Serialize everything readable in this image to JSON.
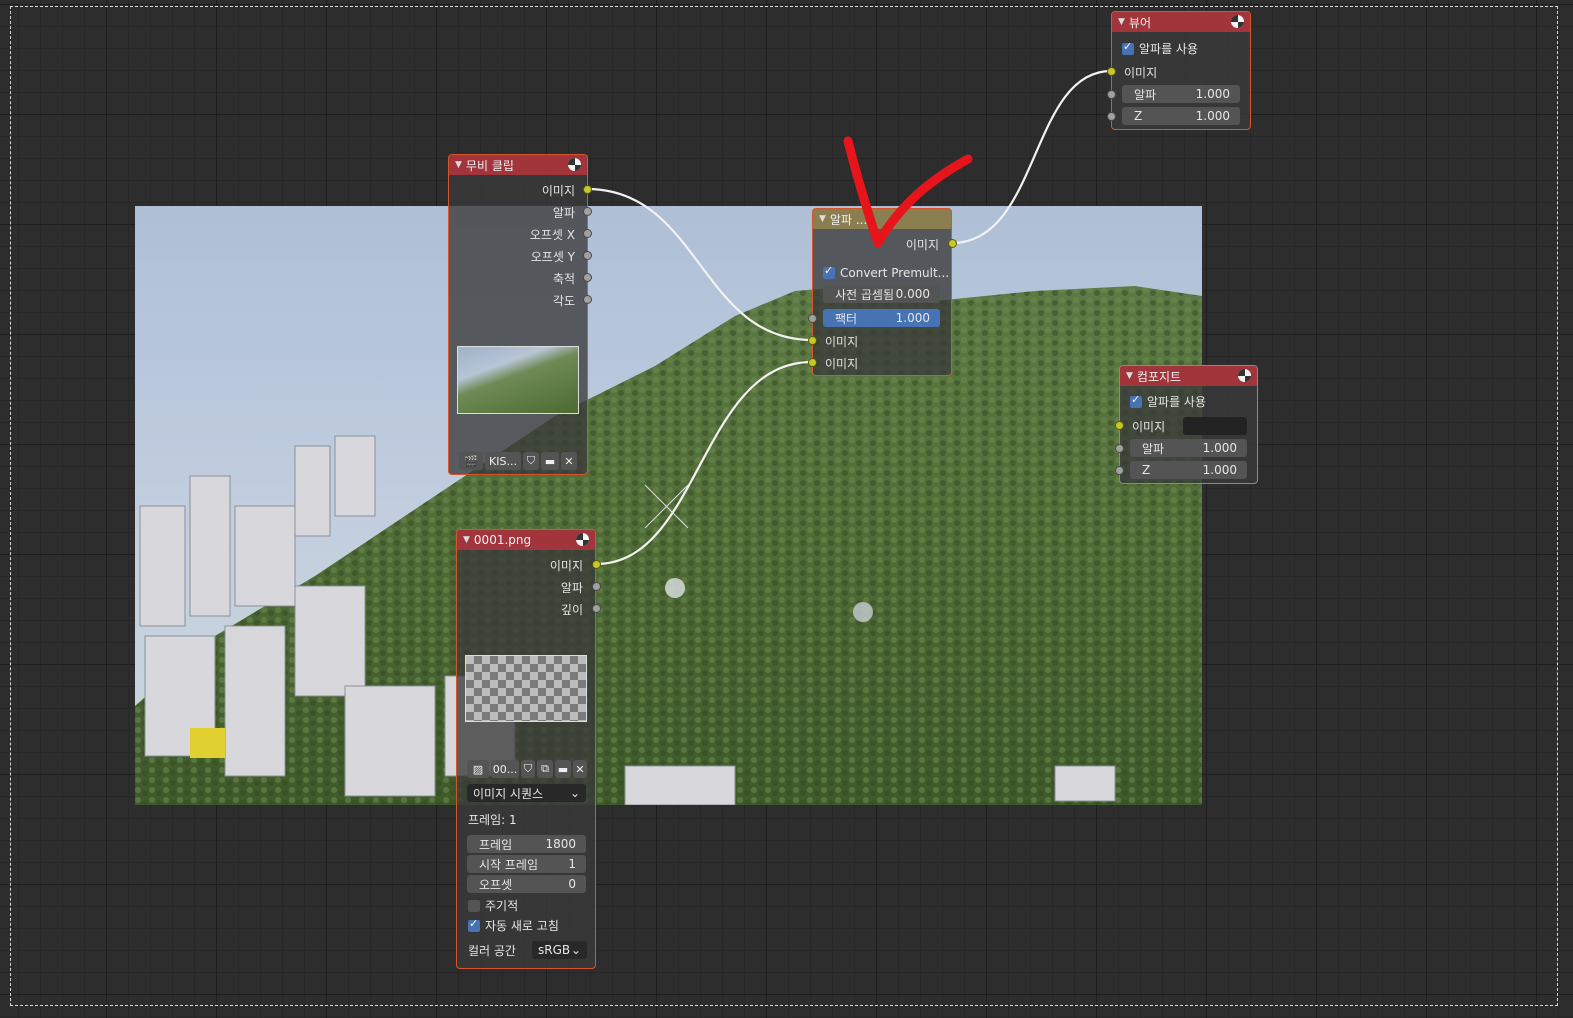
{
  "colors": {
    "accent": "#4772b3",
    "socket_image": "#c7c729",
    "socket_value": "#a1a1a1",
    "node_border": "#d5562b",
    "header_red": "#a2343b",
    "header_olive": "#8b7f52",
    "annotation": "#e8141c"
  },
  "viewer": {
    "title": "뷰어",
    "use_alpha": "알파를 사용",
    "in_image": "이미지",
    "alpha_label": "알파",
    "alpha_value": "1.000",
    "z_label": "Z",
    "z_value": "1.000"
  },
  "movie_clip": {
    "title": "무비 클립",
    "outputs": [
      "이미지",
      "알파",
      "오프셋 X",
      "오프셋 Y",
      "축적",
      "각도"
    ],
    "clip_name": "KIS..."
  },
  "alpha_over": {
    "title": "알파 ...",
    "out_image": "이미지",
    "convert_premult": "Convert Premult...",
    "premul_label": "사전 곱셈됨",
    "premul_value": "0.000",
    "factor_label": "팩터",
    "factor_value": "1.000",
    "in_image_1": "이미지",
    "in_image_2": "이미지"
  },
  "composite": {
    "title": "컴포지트",
    "use_alpha": "알파를 사용",
    "in_image": "이미지",
    "alpha_label": "알파",
    "alpha_value": "1.000",
    "z_label": "Z",
    "z_value": "1.000"
  },
  "image_node": {
    "title": "0001.png",
    "outputs": [
      "이미지",
      "알파",
      "깊이"
    ],
    "image_name": "00...",
    "source": "이미지 시퀀스",
    "frame_info": "프레임: 1",
    "frames_label": "프레임",
    "frames_value": "1800",
    "start_label": "시작 프레임",
    "start_value": "1",
    "offset_label": "오프셋",
    "offset_value": "0",
    "cyclic": "주기적",
    "auto_refresh": "자동 새로 고침",
    "colorspace_label": "컬러 공간",
    "colorspace_value": "sRGB"
  },
  "icons": [
    "preview-icon",
    "collapse-arrow-icon",
    "movieclip-icon",
    "image-icon",
    "shield-icon",
    "folder-icon",
    "close-icon",
    "new-image-icon",
    "chevron-down-icon",
    "checkbox-icon"
  ]
}
